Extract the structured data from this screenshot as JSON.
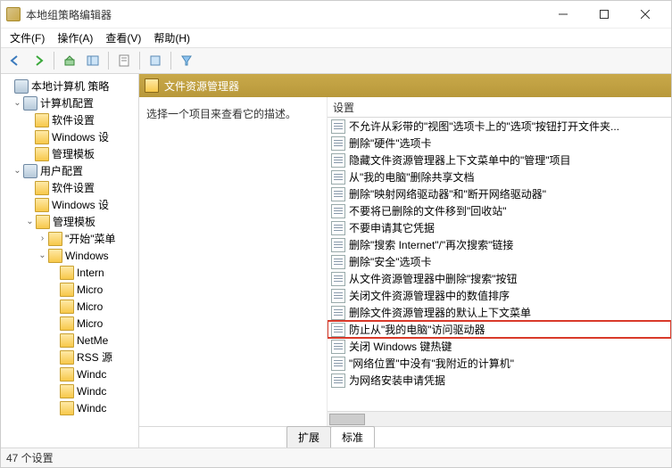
{
  "window": {
    "title": "本地组策略编辑器"
  },
  "menu": {
    "file": "文件(F)",
    "action": "操作(A)",
    "view": "查看(V)",
    "help": "帮助(H)"
  },
  "tree": {
    "root": "本地计算机 策略",
    "computer": "计算机配置",
    "c_soft": "软件设置",
    "c_win": "Windows 设",
    "c_tpl": "管理模板",
    "user": "用户配置",
    "u_soft": "软件设置",
    "u_win": "Windows 设",
    "u_tpl": "管理模板",
    "start": "\"开始\"菜单",
    "winsub": "Windows",
    "items": [
      "Intern",
      "Micro",
      "Micro",
      "Micro",
      "NetMe",
      "RSS 源",
      "Windc",
      "Windc",
      "Windc"
    ]
  },
  "content": {
    "header": "文件资源管理器",
    "desc": "选择一个项目来查看它的描述。",
    "col": "设置",
    "rows": [
      "不允许从彩带的\"视图\"选项卡上的\"选项\"按钮打开文件夹...",
      "删除\"硬件\"选项卡",
      "隐藏文件资源管理器上下文菜单中的\"管理\"项目",
      "从\"我的电脑\"删除共享文档",
      "删除\"映射网络驱动器\"和\"断开网络驱动器\"",
      "不要将已删除的文件移到\"回收站\"",
      "不要申请其它凭据",
      "删除\"搜索 Internet\"/\"再次搜索\"链接",
      "删除\"安全\"选项卡",
      "从文件资源管理器中删除\"搜索\"按钮",
      "关闭文件资源管理器中的数值排序",
      "删除文件资源管理器的默认上下文菜单",
      "防止从\"我的电脑\"访问驱动器",
      "关闭 Windows 键热键",
      "\"网络位置\"中没有\"我附近的计算机\"",
      "为网络安装申请凭据"
    ],
    "highlight": 12
  },
  "tabs": {
    "ext": "扩展",
    "std": "标准"
  },
  "status": "47 个设置"
}
